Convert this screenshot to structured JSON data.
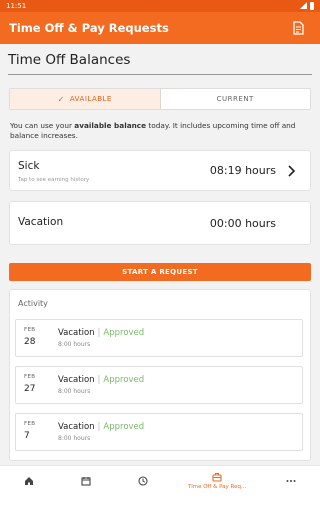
{
  "status_bar": {
    "time": "11:51"
  },
  "app_bar": {
    "title": "Time Off & Pay Requests",
    "action_icon": "document-icon"
  },
  "section": {
    "title": "Time Off Balances"
  },
  "toggle": {
    "available_label": "AVAILABLE",
    "current_label": "CURRENT",
    "selected": "AVAILABLE"
  },
  "info": {
    "prefix": "You can use your ",
    "bold": "available balance",
    "suffix": " today. It includes upcoming time off and balance increases."
  },
  "balances": [
    {
      "name": "Sick",
      "hint": "Tap to see earning history",
      "value": "08:19 hours"
    },
    {
      "name": "Vacation",
      "hint": "",
      "value": "00:00 hours"
    }
  ],
  "start_request_label": "START A REQUEST",
  "activity": {
    "label": "Activity",
    "items": [
      {
        "month": "FEB",
        "day": "28",
        "type": "Vacation",
        "separator": "|",
        "status": "Approved",
        "hours": "8:00 hours"
      },
      {
        "month": "FEB",
        "day": "27",
        "type": "Vacation",
        "separator": "|",
        "status": "Approved",
        "hours": "8:00 hours"
      },
      {
        "month": "FEB",
        "day": "7",
        "type": "Vacation",
        "separator": "|",
        "status": "Approved",
        "hours": "8:00 hours"
      }
    ]
  },
  "bottom_nav": {
    "items": [
      {
        "icon": "home-icon"
      },
      {
        "icon": "calendar-icon"
      },
      {
        "icon": "clock-icon"
      },
      {
        "icon": "briefcase-icon",
        "label": "Time Off & Pay Req..."
      },
      {
        "icon": "more-icon"
      }
    ]
  },
  "colors": {
    "accent": "#f36b21",
    "approved": "#7ab96c"
  }
}
